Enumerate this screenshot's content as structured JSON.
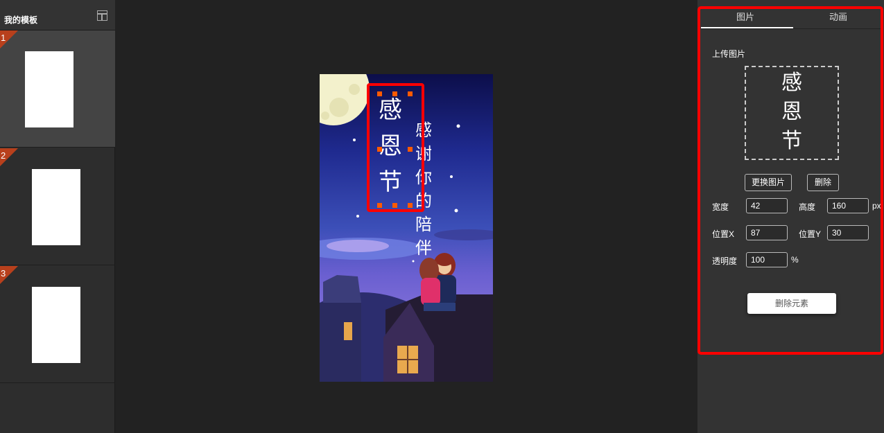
{
  "sidebar": {
    "title": "我的模板",
    "slides": [
      {
        "number": "1"
      },
      {
        "number": "2"
      },
      {
        "number": "3"
      }
    ]
  },
  "poster": {
    "title_chars": [
      "感",
      "恩",
      "节"
    ],
    "subtitle_col1": [
      "感",
      "谢",
      "你"
    ],
    "subtitle_col2": [
      "的",
      "陪",
      "伴"
    ]
  },
  "panel": {
    "tabs": [
      "图片",
      "动画"
    ],
    "upload_label": "上传图片",
    "preview_chars": [
      "感",
      "恩",
      "节"
    ],
    "replace_button": "更换图片",
    "delete_button": "删除",
    "width_label": "宽度",
    "width_value": "42",
    "height_label": "高度",
    "height_value": "160",
    "unit_px": "px",
    "pos_x_label": "位置X",
    "pos_x_value": "87",
    "pos_y_label": "位置Y",
    "pos_y_value": "30",
    "opacity_label": "透明度",
    "opacity_value": "100",
    "unit_percent": "%",
    "delete_element_button": "删除元素"
  }
}
